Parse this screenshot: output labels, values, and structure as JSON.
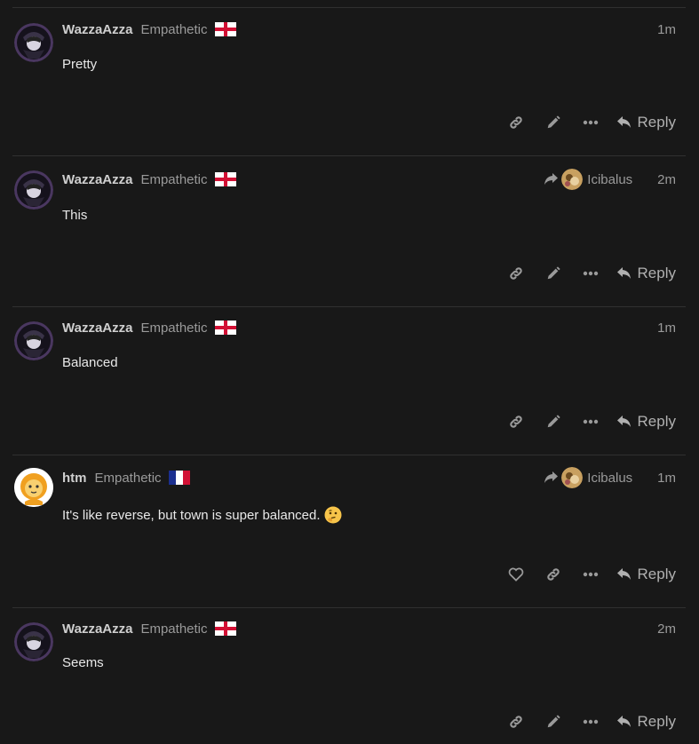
{
  "colors": {
    "background": "#181818",
    "divider": "#303030",
    "icon": "#9a9a9a",
    "flag_red": "#d21034",
    "flag_blue": "#1b2f8f"
  },
  "posts": [
    {
      "username": "WazzaAzza",
      "title": "Empathetic",
      "flag": "england-flag",
      "reply_to": null,
      "time": "1m",
      "content": "Pretty",
      "emoji": null,
      "first_action": "link-icon",
      "second_action": "pencil-icon"
    },
    {
      "username": "WazzaAzza",
      "title": "Empathetic",
      "flag": "england-flag",
      "reply_to": "Icibalus",
      "time": "2m",
      "content": "This",
      "emoji": null,
      "first_action": "link-icon",
      "second_action": "pencil-icon"
    },
    {
      "username": "WazzaAzza",
      "title": "Empathetic",
      "flag": "england-flag",
      "reply_to": null,
      "time": "1m",
      "content": "Balanced",
      "emoji": null,
      "first_action": "link-icon",
      "second_action": "pencil-icon"
    },
    {
      "username": "htm",
      "title": "Empathetic",
      "flag": "france-flag",
      "reply_to": "Icibalus",
      "time": "1m",
      "content": "It's like reverse, but town is super balanced.",
      "emoji": "thinking-face-emoji",
      "first_action": "heart-icon",
      "second_action": "link-icon"
    },
    {
      "username": "WazzaAzza",
      "title": "Empathetic",
      "flag": "england-flag",
      "reply_to": null,
      "time": "2m",
      "content": "Seems",
      "emoji": null,
      "first_action": "link-icon",
      "second_action": "pencil-icon"
    }
  ],
  "reply_label": "Reply"
}
